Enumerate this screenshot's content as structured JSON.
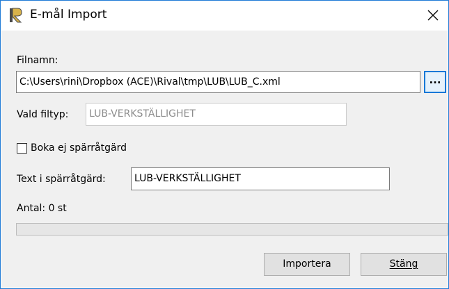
{
  "window": {
    "title": "E-mål Import",
    "app_icon": "app-logo-icon",
    "close_icon": "close-icon"
  },
  "form": {
    "filename_label": "Filnamn:",
    "filename_value": "C:\\Users\\rini\\Dropbox (ACE)\\Rival\\tmp\\LUB\\LUB_C.xml",
    "browse_label": "...",
    "filetype_label": "Vald filtyp:",
    "filetype_value": "LUB-VERKSTÄLLIGHET",
    "checkbox_label": "Boka ej spärråtgärd",
    "checkbox_checked": false,
    "text_label": "Text i spärråtgärd:",
    "text_value": "LUB-VERKSTÄLLIGHET",
    "count_label": "Antal: 0 st",
    "progress": 0
  },
  "buttons": {
    "import_label": "Importera",
    "close_label": "Stäng"
  },
  "colors": {
    "accent": "#0078d7",
    "window_border": "#1f7bd6",
    "dialog_bg": "#f0f0f0",
    "disabled_text": "#8c8c8c"
  }
}
